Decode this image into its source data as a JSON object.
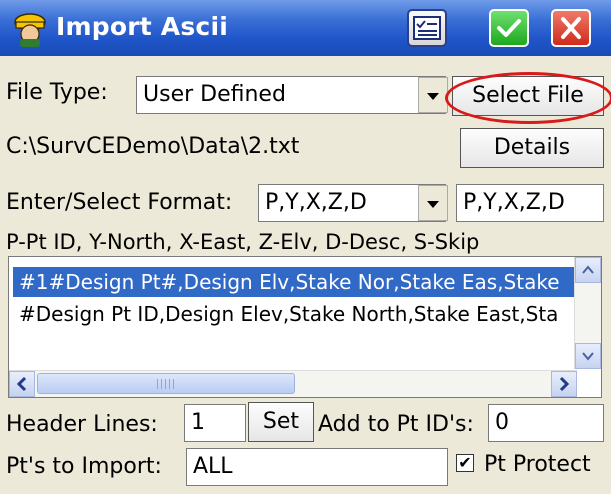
{
  "window": {
    "title": "Import Ascii"
  },
  "file_type": {
    "label": "File Type:",
    "value": "User Defined",
    "select_file_label": "Select File"
  },
  "file_path": {
    "text": "C:\\SurvCEDemo\\Data\\2.txt",
    "details_label": "Details"
  },
  "format": {
    "label": "Enter/Select Format:",
    "selected": "P,Y,X,Z,D",
    "entry": "P,Y,X,Z,D"
  },
  "legend_text": "P-Pt ID, Y-North, X-East, Z-Elv, D-Desc, S-Skip",
  "preview_lines": [
    "#1#Design Pt#,Design Elv,Stake Nor,Stake Eas,Stake",
    "#Design Pt ID,Design Elev,Stake North,Stake East,Sta"
  ],
  "header_lines": {
    "label": "Header Lines:",
    "value": "1",
    "set_label": "Set",
    "add_label": "Add to Pt ID's:",
    "add_value": "0"
  },
  "import": {
    "label": "Pt's to Import:",
    "value": "ALL",
    "protect_label": "Pt Protect",
    "protect_checked": true
  },
  "colors": {
    "title_bar": "#1f55c8",
    "selection": "#3169c6",
    "highlight_circle": "#d81a1a",
    "ok_button": "#1ea81e",
    "close_button": "#d02a1a"
  }
}
